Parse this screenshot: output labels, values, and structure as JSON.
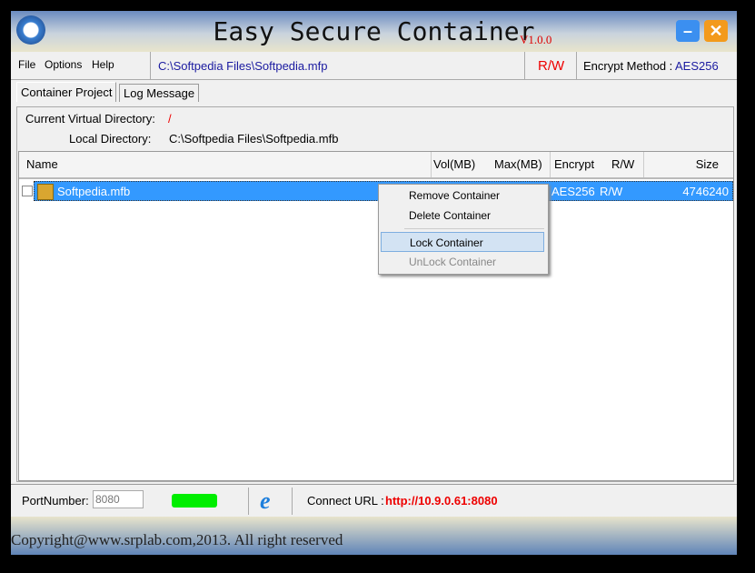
{
  "title": {
    "app_name": "Easy Secure Container",
    "version": "V1.0.0",
    "minimize": "–",
    "close": "✕"
  },
  "menubar": {
    "items": [
      "File",
      "Options",
      "Help"
    ],
    "path": "C:\\Softpedia Files\\Softpedia.mfp",
    "mode": "R/W",
    "encrypt_label": "Encrypt Method : ",
    "encrypt_value": "AES256"
  },
  "tabs": [
    "Container Project",
    "Log Message"
  ],
  "info": {
    "virtual_label": "Current Virtual Directory:",
    "virtual_value": "/",
    "local_label": "Local Directory:",
    "local_value": "C:\\Softpedia Files\\Softpedia.mfb"
  },
  "table": {
    "columns": [
      "Name",
      "Vol(MB)",
      "Max(MB)",
      "Encrypt",
      "R/W",
      "Size"
    ],
    "rows": [
      {
        "name": "Softpedia.mfb",
        "encrypt": "AES256",
        "rw": "R/W",
        "size": "4746240"
      }
    ]
  },
  "context_menu": {
    "items": [
      "Remove Container",
      "Delete Container",
      "Lock Container",
      "UnLock Container"
    ]
  },
  "bottom": {
    "port_label": "PortNumber:",
    "port_value": "8080",
    "url_label": "Connect URL : ",
    "url_value": "http://10.9.0.61:8080",
    "status_color": "#00ee00"
  },
  "footer": {
    "copyright": "Copyright@www.srplab.com,2013. All right reserved"
  }
}
